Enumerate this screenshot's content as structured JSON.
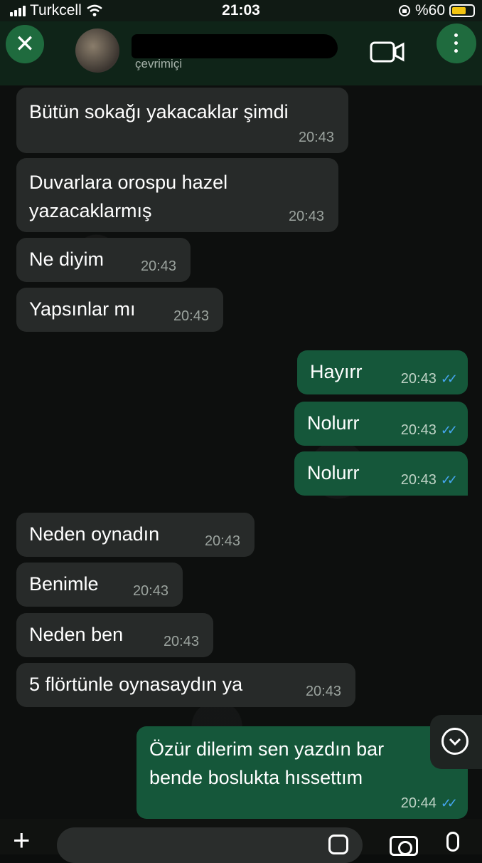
{
  "status_bar": {
    "carrier": "Turkcell",
    "time": "21:03",
    "battery": "%60"
  },
  "header": {
    "contact_name": "",
    "contact_status": "çevrimiçi",
    "close_symbol": "✕"
  },
  "messages": [
    {
      "direction": "in",
      "text": "Bütün sokağı yakacaklar şimdi",
      "time": "20:43"
    },
    {
      "direction": "in",
      "text": "Duvarlara orospu hazel\nyazacaklarmış",
      "time": "20:43"
    },
    {
      "direction": "in",
      "text": "Ne diyim",
      "time": "20:43"
    },
    {
      "direction": "in",
      "text": "Yapsınlar mı",
      "time": "20:43"
    },
    {
      "direction": "out",
      "text": "Hayırr",
      "time": "20:43",
      "ticks": "✓✓"
    },
    {
      "direction": "out",
      "text": "Nolurr",
      "time": "20:43",
      "ticks": "✓✓"
    },
    {
      "direction": "out",
      "text": "Nolurr",
      "time": "20:43",
      "ticks": "✓✓"
    },
    {
      "direction": "in",
      "text": "Neden oynadın",
      "time": "20:43"
    },
    {
      "direction": "in",
      "text": "Benimle",
      "time": "20:43"
    },
    {
      "direction": "in",
      "text": "Neden ben",
      "time": "20:43"
    },
    {
      "direction": "in",
      "text": "5 flörtünle oynasaydın ya",
      "time": "20:43"
    },
    {
      "direction": "out",
      "text": "Özür dilerim sen yazdın bar\nbende boslukta hıssettım",
      "time": "20:44",
      "ticks": "✓✓"
    }
  ],
  "composer": {
    "plus_symbol": "+"
  },
  "colors": {
    "incoming_bubble": "#272a29",
    "outgoing_bubble": "#15573a",
    "read_ticks": "#45a6f0",
    "accent": "#1f6b3e"
  },
  "icons": [
    "close-icon",
    "video-call-icon",
    "menu-icon",
    "scroll-down-icon",
    "plus-icon",
    "sticker-icon",
    "camera-icon",
    "mic-icon"
  ]
}
